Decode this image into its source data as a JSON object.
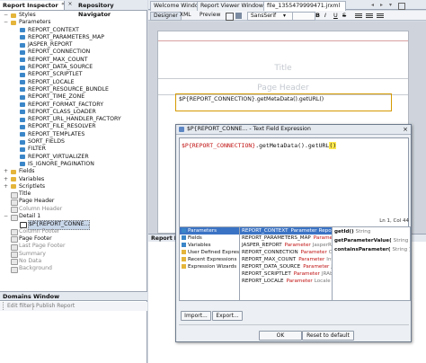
{
  "left_panel": {
    "tabs": [
      "Report Inspector",
      "Repository Navigator"
    ],
    "tab_buttons": [
      "«",
      "×"
    ],
    "tree": [
      {
        "label": "Styles",
        "indent": 1,
        "toggle": "−",
        "icon": "folder",
        "grey": false
      },
      {
        "label": "Parameters",
        "indent": 1,
        "toggle": "−",
        "icon": "folder",
        "grey": false
      },
      {
        "label": "REPORT_CONTEXT",
        "indent": 2,
        "icon": "param",
        "grey": false
      },
      {
        "label": "REPORT_PARAMETERS_MAP",
        "indent": 2,
        "icon": "param",
        "grey": false
      },
      {
        "label": "JASPER_REPORT",
        "indent": 2,
        "icon": "param",
        "grey": false
      },
      {
        "label": "REPORT_CONNECTION",
        "indent": 2,
        "icon": "param",
        "grey": false
      },
      {
        "label": "REPORT_MAX_COUNT",
        "indent": 2,
        "icon": "param",
        "grey": false
      },
      {
        "label": "REPORT_DATA_SOURCE",
        "indent": 2,
        "icon": "param",
        "grey": false
      },
      {
        "label": "REPORT_SCRIPTLET",
        "indent": 2,
        "icon": "param",
        "grey": false
      },
      {
        "label": "REPORT_LOCALE",
        "indent": 2,
        "icon": "param",
        "grey": false
      },
      {
        "label": "REPORT_RESOURCE_BUNDLE",
        "indent": 2,
        "icon": "param",
        "grey": false
      },
      {
        "label": "REPORT_TIME_ZONE",
        "indent": 2,
        "icon": "param",
        "grey": false
      },
      {
        "label": "REPORT_FORMAT_FACTORY",
        "indent": 2,
        "icon": "param",
        "grey": false
      },
      {
        "label": "REPORT_CLASS_LOADER",
        "indent": 2,
        "icon": "param",
        "grey": false
      },
      {
        "label": "REPORT_URL_HANDLER_FACTORY",
        "indent": 2,
        "icon": "param",
        "grey": false
      },
      {
        "label": "REPORT_FILE_RESOLVER",
        "indent": 2,
        "icon": "param",
        "grey": false
      },
      {
        "label": "REPORT_TEMPLATES",
        "indent": 2,
        "icon": "param",
        "grey": false
      },
      {
        "label": "SORT_FIELDS",
        "indent": 2,
        "icon": "param",
        "grey": false
      },
      {
        "label": "FILTER",
        "indent": 2,
        "icon": "param",
        "grey": false
      },
      {
        "label": "REPORT_VIRTUALIZER",
        "indent": 2,
        "icon": "param",
        "grey": false
      },
      {
        "label": "IS_IGNORE_PAGINATION",
        "indent": 2,
        "icon": "param",
        "grey": false
      },
      {
        "label": "Fields",
        "indent": 1,
        "toggle": "+",
        "icon": "folder",
        "grey": false
      },
      {
        "label": "Variables",
        "indent": 1,
        "toggle": "+",
        "icon": "folder",
        "grey": false
      },
      {
        "label": "Scriptlets",
        "indent": 1,
        "toggle": "+",
        "icon": "folder",
        "grey": false
      },
      {
        "label": "Title",
        "indent": 1,
        "icon": "band",
        "grey": false
      },
      {
        "label": "Page Header",
        "indent": 1,
        "icon": "band",
        "grey": false
      },
      {
        "label": "Column Header",
        "indent": 1,
        "icon": "band",
        "grey": true
      },
      {
        "label": "Detail 1",
        "indent": 1,
        "toggle": "−",
        "icon": "band",
        "grey": false
      },
      {
        "label": "$P{REPORT_CONNE...",
        "indent": 2,
        "icon": "field",
        "grey": false,
        "selected": true
      },
      {
        "label": "Column Footer",
        "indent": 1,
        "icon": "band",
        "grey": true
      },
      {
        "label": "Page Footer",
        "indent": 1,
        "icon": "band",
        "grey": false
      },
      {
        "label": "Last Page Footer",
        "indent": 1,
        "icon": "band",
        "grey": true
      },
      {
        "label": "Summary",
        "indent": 1,
        "icon": "band",
        "grey": true
      },
      {
        "label": "No Data",
        "indent": 1,
        "icon": "band",
        "grey": true
      },
      {
        "label": "Background",
        "indent": 1,
        "icon": "band",
        "grey": true
      }
    ],
    "domains_title": "Domains Window",
    "domains_buttons": [
      "Edit filters",
      "Publish Report"
    ]
  },
  "editor_tabs": [
    "Welcome Window",
    "Report Viewer Window",
    "file_1355479999471.jrxml"
  ],
  "designer_toolbar": {
    "designer": "Designer",
    "xml": "XML",
    "preview": "Preview",
    "font": "SansSerif"
  },
  "page": {
    "title_band": "Title",
    "header_band": "Page Header",
    "field_text": "$P{REPORT_CONNECTION}.getMetaData().getURL()"
  },
  "bottom_panel_title": "Report P",
  "dialog": {
    "title": "$P{REPORT_CONNE... - Text Field Expression",
    "expression": "$P{REPORT_CONNECTION}.getMetaData().getURL()",
    "expression_var": "$P{REPORT_CONNECTION}",
    "expression_rest": ".getMetaData().getURL",
    "expression_paren": "()",
    "cursor_info": "Ln 1, Col 44",
    "categories": [
      "Parameters",
      "Fields",
      "Variables",
      "User Defined Expressions",
      "Recent Expressions",
      "Expression Wizards"
    ],
    "objects": [
      {
        "name": "REPORT_CONTEXT",
        "kind": "Parameter",
        "type": "ReportC"
      },
      {
        "name": "REPORT_PARAMETERS_MAP",
        "kind": "Parameter",
        "type": "Map"
      },
      {
        "name": "JASPER_REPORT",
        "kind": "Parameter",
        "type": "JasperRe"
      },
      {
        "name": "REPORT_CONNECTION",
        "kind": "Parameter",
        "type": "Connect"
      },
      {
        "name": "REPORT_MAX_COUNT",
        "kind": "Parameter",
        "type": "Integer"
      },
      {
        "name": "REPORT_DATA_SOURCE",
        "kind": "Parameter",
        "type": "JRDataS"
      },
      {
        "name": "REPORT_SCRIPTLET",
        "kind": "Parameter",
        "type": "JRAbstr"
      },
      {
        "name": "REPORT_LOCALE",
        "kind": "Parameter",
        "type": "Locale"
      }
    ],
    "methods": [
      {
        "name": "getId()",
        "type": "String"
      },
      {
        "name": "getParameterValue(",
        "type": "String )"
      },
      {
        "name": "containsParameter(",
        "type": "String )"
      }
    ],
    "import_button": "Import...",
    "export_button": "Export...",
    "ok_button": "OK",
    "reset_button": "Reset to default"
  },
  "colors": {
    "selection": "#3b73c4",
    "param_icon": "#3a86c8",
    "folder_icon": "#e4b53a",
    "param_red": "#c01010",
    "var_orange": "#cc4400"
  }
}
